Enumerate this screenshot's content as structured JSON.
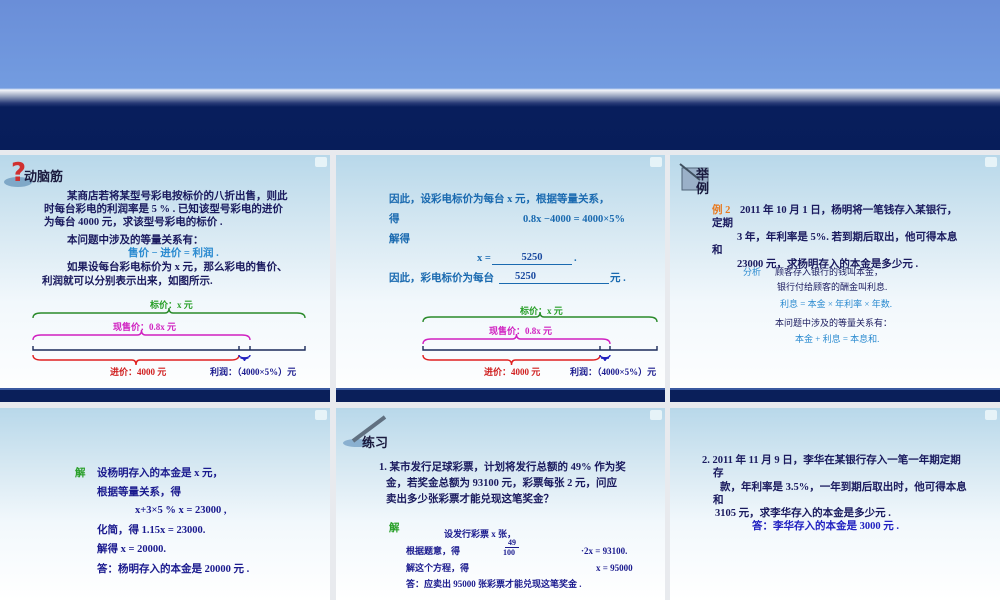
{
  "slides": [
    {
      "title": "动脑筋",
      "lines": [
        "某商店若将某型号彩电按标价的八折出售，则此",
        "时每台彩电的利润率是 5 % . 已知该型号彩电的进价",
        "为每台 4000 元，求该型号彩电的标价 .",
        "本问题中涉及的等量关系有：",
        "售价 − 进价 = 利润 .",
        "如果设每台彩电标价为 x 元，那么彩电的售价、",
        "利润就可以分别表示出来，如图所示."
      ],
      "diagram": {
        "list_price": "标价：x 元",
        "sale_price": "现售价：0.8x 元",
        "cost": "进价：4000 元",
        "profit": "利润：（4000×5%）元"
      }
    },
    {
      "lines": [
        "因此，设彩电标价为每台 x 元，根据等量关系，",
        "得",
        "0.8x −4000 = 4000×5%",
        "解得",
        "x =",
        "5250",
        ".",
        "因此，彩电标价为每台",
        "5250",
        "元 ."
      ],
      "diagram": {
        "list_price": "标价：x 元",
        "sale_price": "现售价：0.8x 元",
        "cost": "进价：4000 元",
        "profit": "利润：（4000×5%）元"
      }
    },
    {
      "title": "举例",
      "example_label": "例 2",
      "lines": [
        "2011 年 10 月 1 日，杨明将一笔钱存入某银行，",
        "定期",
        "3 年，年利率是 5%. 若到期后取出，他可得本息",
        "和",
        "23000 元，求杨明存入的本金是多少元 .",
        "分析",
        "顾客存入银行的钱叫本金，",
        "银行付给顾客的酬金叫利息.",
        "利息 = 本金 × 年利率 × 年数.",
        "本问题中涉及的等量关系有：",
        "本金  +  利息  =  本息和."
      ]
    },
    {
      "solve_label": "解",
      "lines": [
        "设杨明存入的本金是  x  元，",
        "根据等量关系，得",
        "x+3×5 % x = 23000 ,",
        "化简，得   1.15x = 23000.",
        "解得   x = 20000.",
        "答：杨明存入的本金是 20000 元 ."
      ]
    },
    {
      "title": "练习",
      "question": [
        "1. 某市发行足球彩票，计划将发行总额的 49% 作为奖",
        "金，若奖金总额为 93100 元，彩票每张 2 元，问应",
        "卖出多少张彩票才能兑现这笔奖金？"
      ],
      "solve_label": "解",
      "lines": [
        "设发行彩票 x 张，",
        "根据题意，得",
        "49",
        "100",
        "·2x = 93100.",
        "解这个方程，得",
        "x = 95000",
        "答：应卖出 95000 张彩票才能兑现这笔奖金 ."
      ]
    },
    {
      "lines": [
        "2.  2011 年 11 月 9 日，李华在某银行存入一笔一年期定期",
        "存",
        "款，年利率是 3.5%，一年到期后取出时，他可得本息",
        "和",
        "3105 元，求李华存入的本金是多少元 .",
        "答：李华存入的本金是 3000 元 ."
      ]
    }
  ],
  "colors": {
    "banner_top": "#6a8ed8",
    "banner_dark": "#071d5a",
    "blue_text": "#2a8ad0",
    "navy_text": "#1a1a8e",
    "green": "#2aa02a"
  }
}
